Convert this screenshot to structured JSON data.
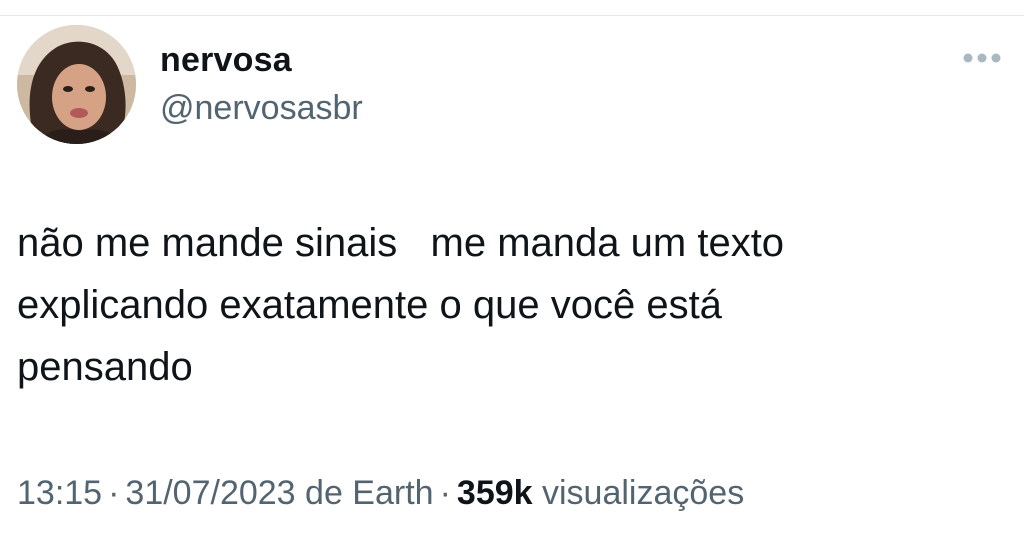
{
  "tweet": {
    "author": {
      "display_name": "nervosa",
      "handle": "@nervosasbr",
      "avatar_icon": "profile-photo"
    },
    "more_icon": "ellipsis-horizontal-icon",
    "text": "não me mande sinais   me manda um texto\nexplicando exatamente o que você está\npensando",
    "time": "13:15",
    "separator": "·",
    "date": "31/07/2023",
    "source": "de Earth",
    "views_count": "359k",
    "views_label": "visualizações"
  },
  "colors": {
    "text_primary": "#0f1419",
    "text_secondary": "#536471",
    "divider": "#e6e8ea",
    "icon": "#aab8c2"
  }
}
